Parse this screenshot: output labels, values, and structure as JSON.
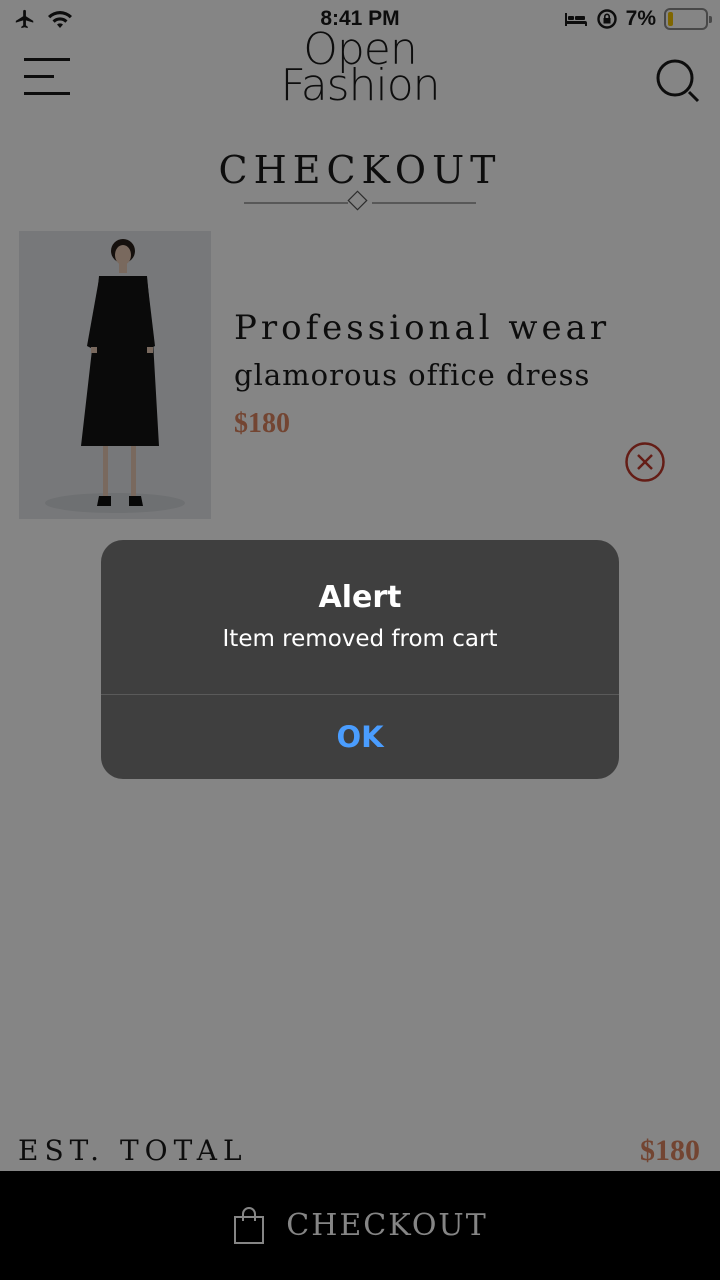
{
  "status_bar": {
    "time": "8:41 PM",
    "battery_text": "7%",
    "battery_level": 0.07,
    "icons": [
      "airplane-icon",
      "wifi-icon",
      "bed-icon",
      "rotation-lock-icon",
      "battery-icon"
    ]
  },
  "header": {
    "logo_line1": "Open",
    "logo_line2": "Fashion",
    "menu_icon": "menu-icon",
    "search_icon": "search-icon"
  },
  "page": {
    "title": "CHECKOUT"
  },
  "cart": {
    "items": [
      {
        "name": "Professional wear",
        "subtitle": "glamorous office dress",
        "price": "$180",
        "remove_icon": "remove-circle-x-icon"
      }
    ]
  },
  "totals": {
    "label": "EST. TOTAL",
    "value": "$180"
  },
  "checkout_button": {
    "label": "CHECKOUT",
    "icon": "shopping-bag-icon"
  },
  "alert": {
    "title": "Alert",
    "message": "Item removed from cart",
    "ok_label": "OK"
  },
  "colors": {
    "accent_price": "#dd8560",
    "remove_red": "#c0392b",
    "alert_link": "#4a9dff",
    "checkout_bg": "#000000"
  }
}
